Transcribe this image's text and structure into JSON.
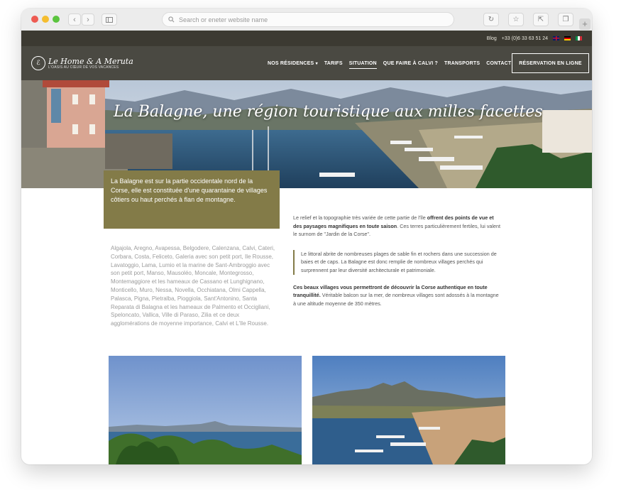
{
  "browser": {
    "url_placeholder": "Search or eneter website name"
  },
  "topbar": {
    "blog": "Blog",
    "phone": "+33 (0)6 33 63 51 24"
  },
  "logo": {
    "title": "Le Home & A Meruta",
    "subtitle": "L'OASIS AU CŒUR DE VOS VACANCES"
  },
  "menu": {
    "items": [
      "NOS RÉSIDENCES",
      "TARIFS",
      "SITUATION",
      "QUE FAIRE À CALVI ?",
      "TRANSPORTS",
      "CONTACT"
    ],
    "reserve": "RÉSERVATION EN LIGNE"
  },
  "hero": {
    "title": "La Balagne, une région touristique aux milles facettes"
  },
  "intro": "La Balagne est sur la partie occidentale nord de la Corse, elle est constituée d'une quarantaine de villages côtiers ou haut perchés à flan de montagne.",
  "villages": "Algajola, Aregno, Avapessa, Belgodere, Calenzana, Calvi, Cateri, Corbara, Costa, Feliceto, Galeria avec son petit port, Ile Rousse, Lavatoggio, Lama, Lumio et la marine de Sant-Ambroggio avec son petit port, Manso, Mausoléo, Moncale, Montegrosso, Montemaggiore et les hameaux de Cassano et Lunghignano, Monticello, Muro, Nessa, Novella, Occhiatana, Olmi Cappella, Palasca, Pigna, Pietralba, Pioggiola, Sant'Antonino, Santa Reparata di Balagna et les hameaux de Palmento et Occigliani, Speloncato, Vallica, Ville di Paraso, Zilia et ce deux agglomérations de moyenne importance, Calvi et L'Ile Rousse.",
  "right": {
    "p1_a": "Le relief et la topographie très variée de cette partie de l'île ",
    "p1_b": "offrent des points de vue et des paysages magnifiques en toute saison",
    "p1_c": ". Ces terres particulièrement fertiles, lui valent le surnom de \"Jardin de la Corse\".",
    "quote": "Le littoral abrite de nombreuses plages de sable fin et rochers dans une succession de baies et de caps. La Balagne est donc remplie de nombreux villages perchés qui surprennent par leur diversité architecturale et patrimoniale.",
    "p3_a": "Ces beaux villages vous permettront de découvrir la Corse authentique en toute tranquillité.",
    "p3_b": " Véritable balcon sur la mer, de nombreux villages sont adossés à la montagne à une altitude moyenne de 350 mètres."
  },
  "colors": {
    "olive": "#837b48",
    "nav": "#4a4942",
    "topbar": "#3c3a32"
  }
}
